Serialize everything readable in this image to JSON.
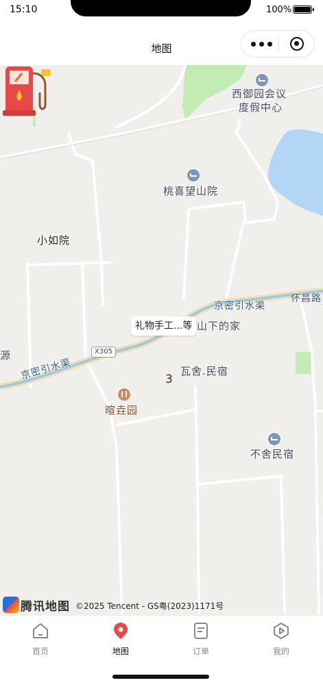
{
  "status_bar": {
    "time": "15:10",
    "battery": "100%"
  },
  "nav": {
    "title": "地图"
  },
  "map": {
    "pois": [
      {
        "id": "xiyuyuan",
        "text": "西御园会议",
        "text2": "度假中心",
        "type": "hotel"
      },
      {
        "id": "taoxi",
        "text": "桃喜望山院",
        "type": "hotel"
      },
      {
        "id": "xiaoru",
        "text": "小如院",
        "type": "area"
      },
      {
        "id": "waishe",
        "text": "瓦舍.民宿",
        "type": "hotel"
      },
      {
        "id": "xuanyuan",
        "text": "暄垚园",
        "type": "food"
      },
      {
        "id": "bushe",
        "text": "不舍民宿",
        "type": "hotel"
      },
      {
        "id": "yuan",
        "text": "源",
        "type": "area"
      },
      {
        "id": "shanxia",
        "text": "山下的家",
        "type": "area"
      }
    ],
    "roads": {
      "canal_1": "京密引水渠",
      "canal_2": "京密引水渠",
      "huaichang": "怀昌路",
      "x305": "X305"
    },
    "callout": "礼物手工...等",
    "cluster_count": "3",
    "logo": "腾讯地图",
    "copyright": "©2025 Tencent - GS粤(2023)1171号"
  },
  "tabs": [
    {
      "label": "首页",
      "icon": "home-icon",
      "active": false
    },
    {
      "label": "地图",
      "icon": "map-pin-icon",
      "active": true
    },
    {
      "label": "订单",
      "icon": "order-icon",
      "active": false
    },
    {
      "label": "我的",
      "icon": "profile-icon",
      "active": false
    }
  ],
  "colors": {
    "accent": "#e84848",
    "water": "#b3d6f7",
    "park": "#c3ecb4",
    "map_bg": "#f1efec"
  }
}
